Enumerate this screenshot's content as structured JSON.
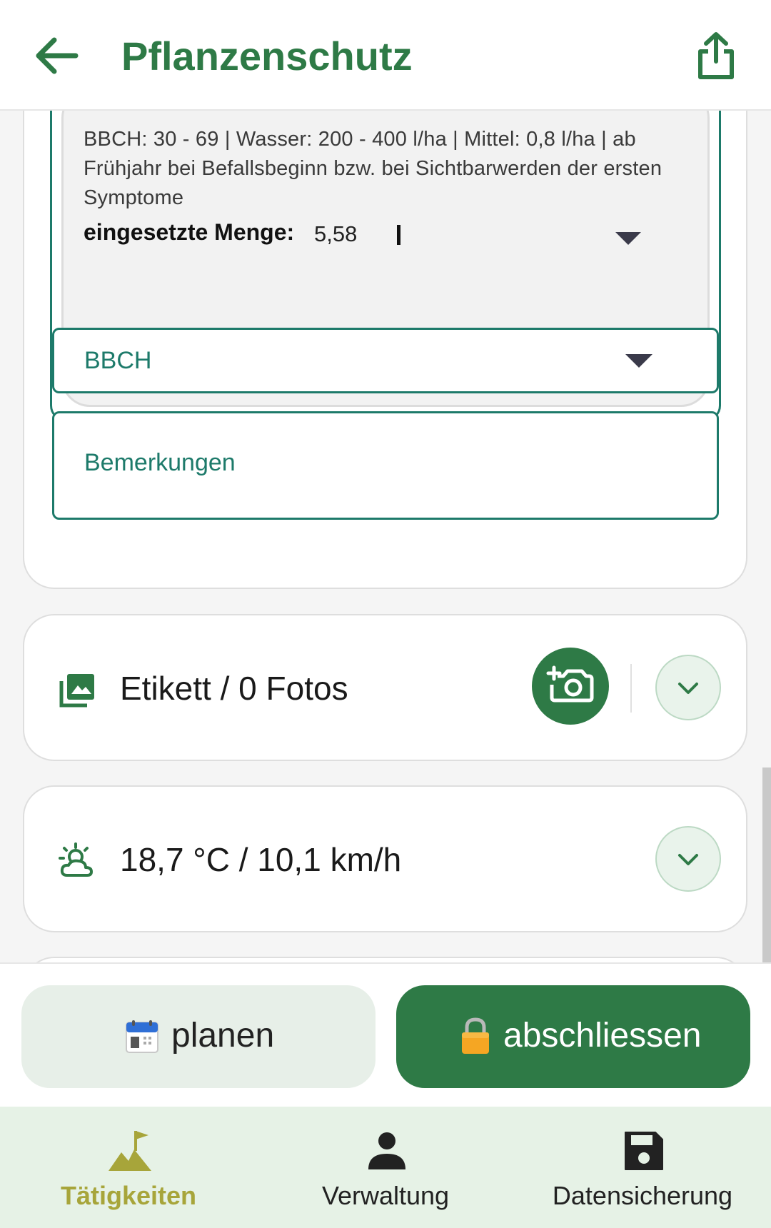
{
  "appbar": {
    "title": "Pflanzenschutz",
    "back_icon": "arrow-back-icon",
    "share_icon": "share-icon"
  },
  "treatment": {
    "description": "BBCH: 30 - 69 | Wasser: 200 - 400 l/ha | Mittel: 0,8 l/ha | ab Frühjahr bei Befallsbeginn bzw. bei Sichtbarwerden der ersten Symptome",
    "menge_label": "eingesetzte Menge:",
    "menge_value": "5,58"
  },
  "form": {
    "bbch_label": "BBCH",
    "remarks_label": "Bemerkungen"
  },
  "photos": {
    "label": "Etikett / 0 Fotos",
    "icon": "photo-library-icon",
    "camera_icon": "add-camera-icon",
    "expand_icon": "chevron-down-icon"
  },
  "weather": {
    "label": "18,7 °C / 10,1 km/h",
    "icon": "weather-partly-cloudy-icon",
    "expand_icon": "chevron-down-icon"
  },
  "actions": {
    "plan_label": "planen",
    "plan_icon": "calendar-icon",
    "close_label": "abschliessen",
    "close_icon": "lock-icon"
  },
  "bottom_nav": {
    "items": [
      {
        "label": "Tätigkeiten",
        "icon": "mountain-flag-icon",
        "active": true
      },
      {
        "label": "Verwaltung",
        "icon": "person-icon",
        "active": false
      },
      {
        "label": "Datensicherung",
        "icon": "save-icon",
        "active": false
      }
    ]
  },
  "colors": {
    "primary": "#2e7a46",
    "teal": "#1d7a6a",
    "active_nav": "#a7a53a",
    "nav_bg": "#e6f2e6"
  }
}
